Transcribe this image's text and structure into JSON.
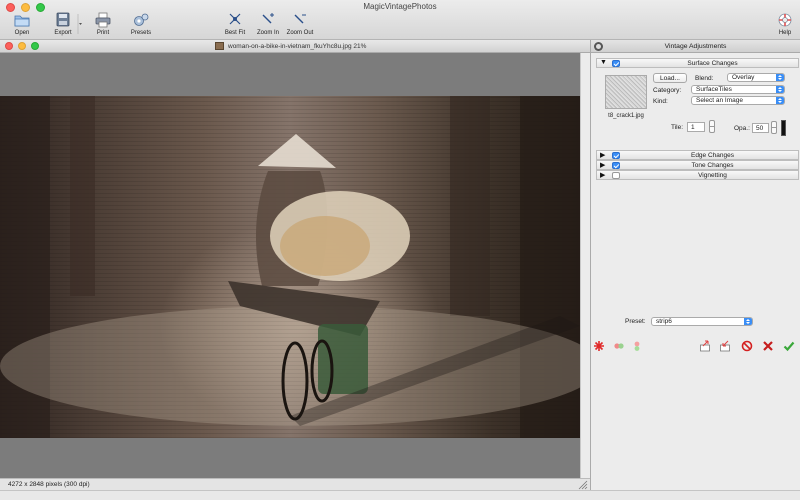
{
  "app": {
    "title": "MagicVintagePhotos"
  },
  "toolbar": {
    "open": "Open",
    "export": "Export",
    "print": "Print",
    "presets": "Presets",
    "best_fit": "Best Fit",
    "zoom_in": "Zoom In",
    "zoom_out": "Zoom Out",
    "help": "Help"
  },
  "document": {
    "title": "woman-on-a-bike-in-vietnam_fkuYhc8u.jpg 21%",
    "status": "4272 x 2848 pixels (300 dpi)"
  },
  "panel": {
    "title": "Vintage Adjustments",
    "sections": [
      {
        "label": "Surface Changes",
        "expanded": true,
        "checked": true
      },
      {
        "label": "Edge Changes",
        "expanded": false,
        "checked": true
      },
      {
        "label": "Tone Changes",
        "expanded": false,
        "checked": true
      },
      {
        "label": "Vignetting",
        "expanded": false,
        "checked": false
      }
    ],
    "surface": {
      "texture_name": "t8_crack1.jpg",
      "load_label": "Load...",
      "blend_label": "Blend:",
      "blend_value": "Overlay",
      "category_label": "Category:",
      "category_value": "SurfaceTiles",
      "kind_label": "Kind:",
      "kind_value": "Select an Image",
      "tile_label": "Tile:",
      "tile_value": "1",
      "opacity_label": "Opa.:",
      "opacity_value": "50"
    },
    "preset_label": "Preset:",
    "preset_value": "strip6"
  },
  "colors": {
    "accent": "#3a8ef6",
    "photo_dark": "#2e2420",
    "canvas_bg": "#7c7c7c"
  }
}
